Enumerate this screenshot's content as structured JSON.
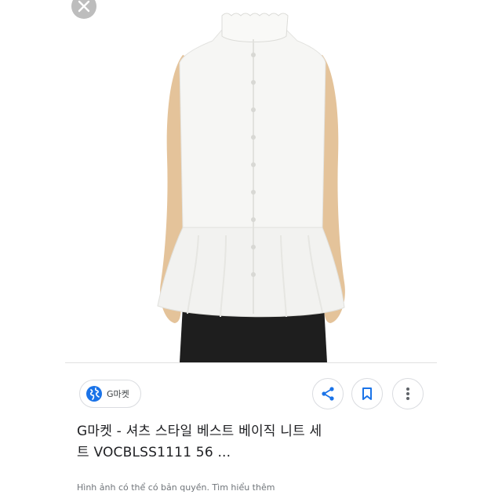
{
  "source": {
    "name": "G마켓"
  },
  "result": {
    "title_line1": "G마켓 - 셔츠 스타일 베스트 베이직 니트 세",
    "title_line2": "트 VOCBLSS1111 56 ..."
  },
  "footer": {
    "notice": "Hình ảnh có thể có bản quyền. Tìm hiểu thêm"
  },
  "colors": {
    "accent": "#1a73e8",
    "icon_gray": "#5f6368",
    "close_gray": "#bdbdbd"
  },
  "icons": {
    "close": "close-icon",
    "source": "globe-icon",
    "share": "share-icon",
    "save": "bookmark-icon",
    "more": "more-vert-icon"
  }
}
